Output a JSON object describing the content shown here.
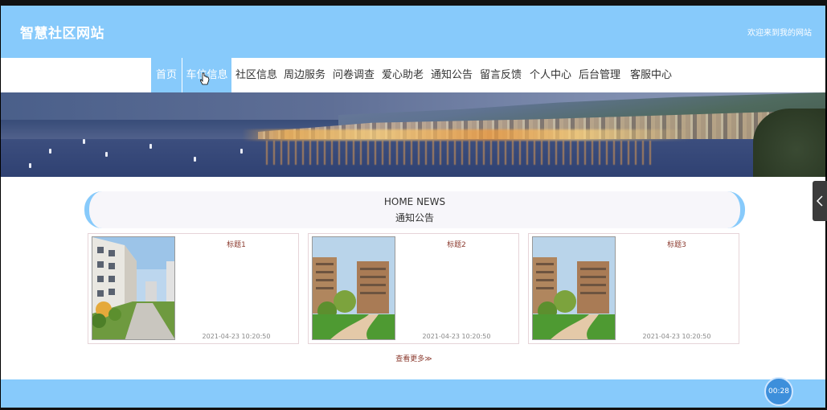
{
  "header": {
    "site_title": "智慧社区网站",
    "welcome_text": "欢迎来到我的网站"
  },
  "nav": {
    "items": [
      {
        "label": "首页",
        "state": "active"
      },
      {
        "label": "车位信息",
        "state": "hover"
      },
      {
        "label": "社区信息"
      },
      {
        "label": "周边服务"
      },
      {
        "label": "问卷调查"
      },
      {
        "label": "爱心助老"
      },
      {
        "label": "通知公告"
      },
      {
        "label": "留言反馈"
      },
      {
        "label": "个人中心"
      },
      {
        "label": "后台管理"
      },
      {
        "label": "客服中心"
      }
    ]
  },
  "banner": {
    "slide_count": 3,
    "active_slide": 1
  },
  "section": {
    "title_en": "HOME NEWS",
    "title_cn": "通知公告"
  },
  "cards": [
    {
      "title": "标题1",
      "time": "2021-04-23 10:20:50",
      "image": "apartment-street-photo"
    },
    {
      "title": "标题2",
      "time": "2021-04-23 10:20:50",
      "image": "residential-towers-garden-photo"
    },
    {
      "title": "标题3",
      "time": "2021-04-23 10:20:50",
      "image": "residential-towers-garden-photo"
    }
  ],
  "more_link": "查看更多≫",
  "timer": "00:28",
  "colors": {
    "accent": "#87cafb",
    "title_text": "#8b3a2e",
    "side_tab": "#3b3b3b"
  }
}
